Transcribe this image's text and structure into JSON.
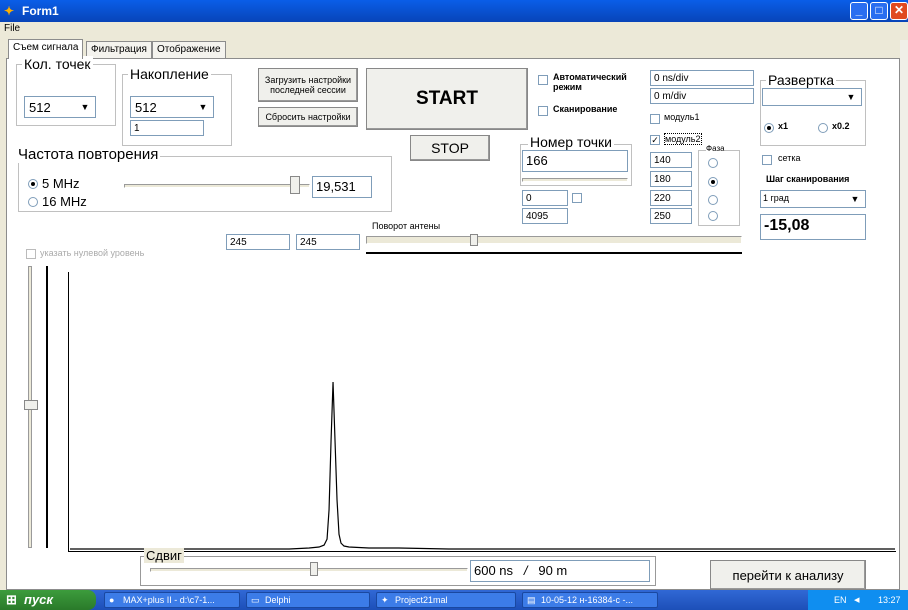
{
  "window": {
    "title": "Form1",
    "menu": [
      "File"
    ]
  },
  "tabs": [
    {
      "label": "Съем сигнала",
      "active": true
    },
    {
      "label": "Фильтрация",
      "active": false
    },
    {
      "label": "Отображение",
      "active": false
    }
  ],
  "points": {
    "label": "Кол. точек",
    "value": "512"
  },
  "accumulation": {
    "label": "Накопление",
    "value": "512",
    "edit": "1"
  },
  "buttons": {
    "load_settings": "Загрузить настройки последней сессии",
    "reset_settings": "Сбросить настройки",
    "start": "START",
    "stop": "STOP",
    "go_to_analysis": "перейти к анализу"
  },
  "auto_mode": {
    "label": "Автоматический режим",
    "checked": false
  },
  "scan": {
    "label": "Сканирование",
    "checked": false
  },
  "scale_fields": {
    "ns_div": "0 ns/div",
    "m_div": "0 m/div"
  },
  "sweep": {
    "label": "Развертка",
    "value": "",
    "x1": "x1",
    "x02": "x0.2",
    "selected": "x1"
  },
  "module1": {
    "label": "модуль1",
    "checked": false
  },
  "module2": {
    "label": "модуль2",
    "checked": true
  },
  "point_number": {
    "label": "Номер точки",
    "value": "166"
  },
  "phase": {
    "label": "Фаза",
    "values": [
      "140",
      "180",
      "220",
      "250"
    ],
    "selected_index": 1
  },
  "small_fields": {
    "a": "0",
    "b": "4095"
  },
  "frequency": {
    "label": "Частота повторения",
    "opt1": "5 MHz",
    "opt2": "16 MHz",
    "selected": "5 MHz",
    "value": "19,531"
  },
  "grid": {
    "label": "сетка",
    "checked": false
  },
  "scan_step": {
    "label": "Шаг сканирования",
    "value": "1 град"
  },
  "angle_value": "-15,08",
  "antenna": {
    "label": "Поворот антены"
  },
  "zero_level": {
    "label": "указать нулевой уровень",
    "checked": false
  },
  "edits_245": [
    "245",
    "245"
  ],
  "shift": {
    "label": "Сдвиг",
    "time": "600 ns",
    "sep": "/",
    "distance": "90 m"
  },
  "taskbar": {
    "start": "пуск",
    "tasks": [
      "MAX+plus II - d:\\c7-1...",
      "Delphi",
      "Project21mal",
      "10-05-12 н-16384-с -..."
    ],
    "lang": "EN",
    "clock": "13:27"
  },
  "chart_data": {
    "type": "line",
    "x": [
      0,
      60,
      120,
      180,
      220,
      240,
      250,
      255,
      258,
      260,
      262,
      264,
      266,
      268,
      270,
      272,
      275,
      280,
      300,
      330,
      380,
      500,
      828
    ],
    "y": [
      0,
      0,
      0,
      0,
      0,
      1,
      2,
      4,
      10,
      40,
      110,
      170,
      110,
      50,
      15,
      6,
      3,
      2,
      1,
      1,
      0,
      0,
      0
    ],
    "ylim": [
      0,
      280
    ],
    "xlim": [
      0,
      828
    ]
  }
}
